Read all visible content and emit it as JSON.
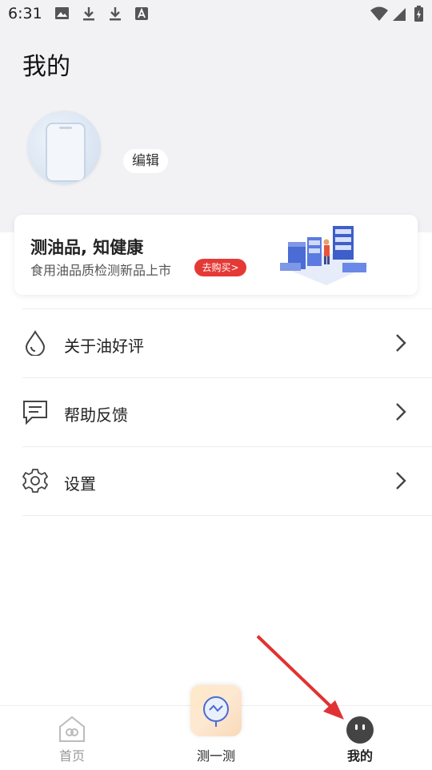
{
  "status_bar": {
    "time": "6:31"
  },
  "header": {
    "title": "我的"
  },
  "profile": {
    "edit_label": "编辑"
  },
  "banner": {
    "title": "测油品, 知健康",
    "subtitle": "食用油品质检测新品上市",
    "button": "去购买>"
  },
  "menu": [
    {
      "label": "关于油好评",
      "icon": "oil-drop-icon"
    },
    {
      "label": "帮助反馈",
      "icon": "chat-icon"
    },
    {
      "label": "设置",
      "icon": "gear-icon"
    }
  ],
  "bottom_nav": {
    "home": "首页",
    "test": "测一测",
    "mine": "我的"
  },
  "colors": {
    "accent_red": "#e53935",
    "active_tab": "#222222",
    "inactive_tab": "#999999"
  }
}
